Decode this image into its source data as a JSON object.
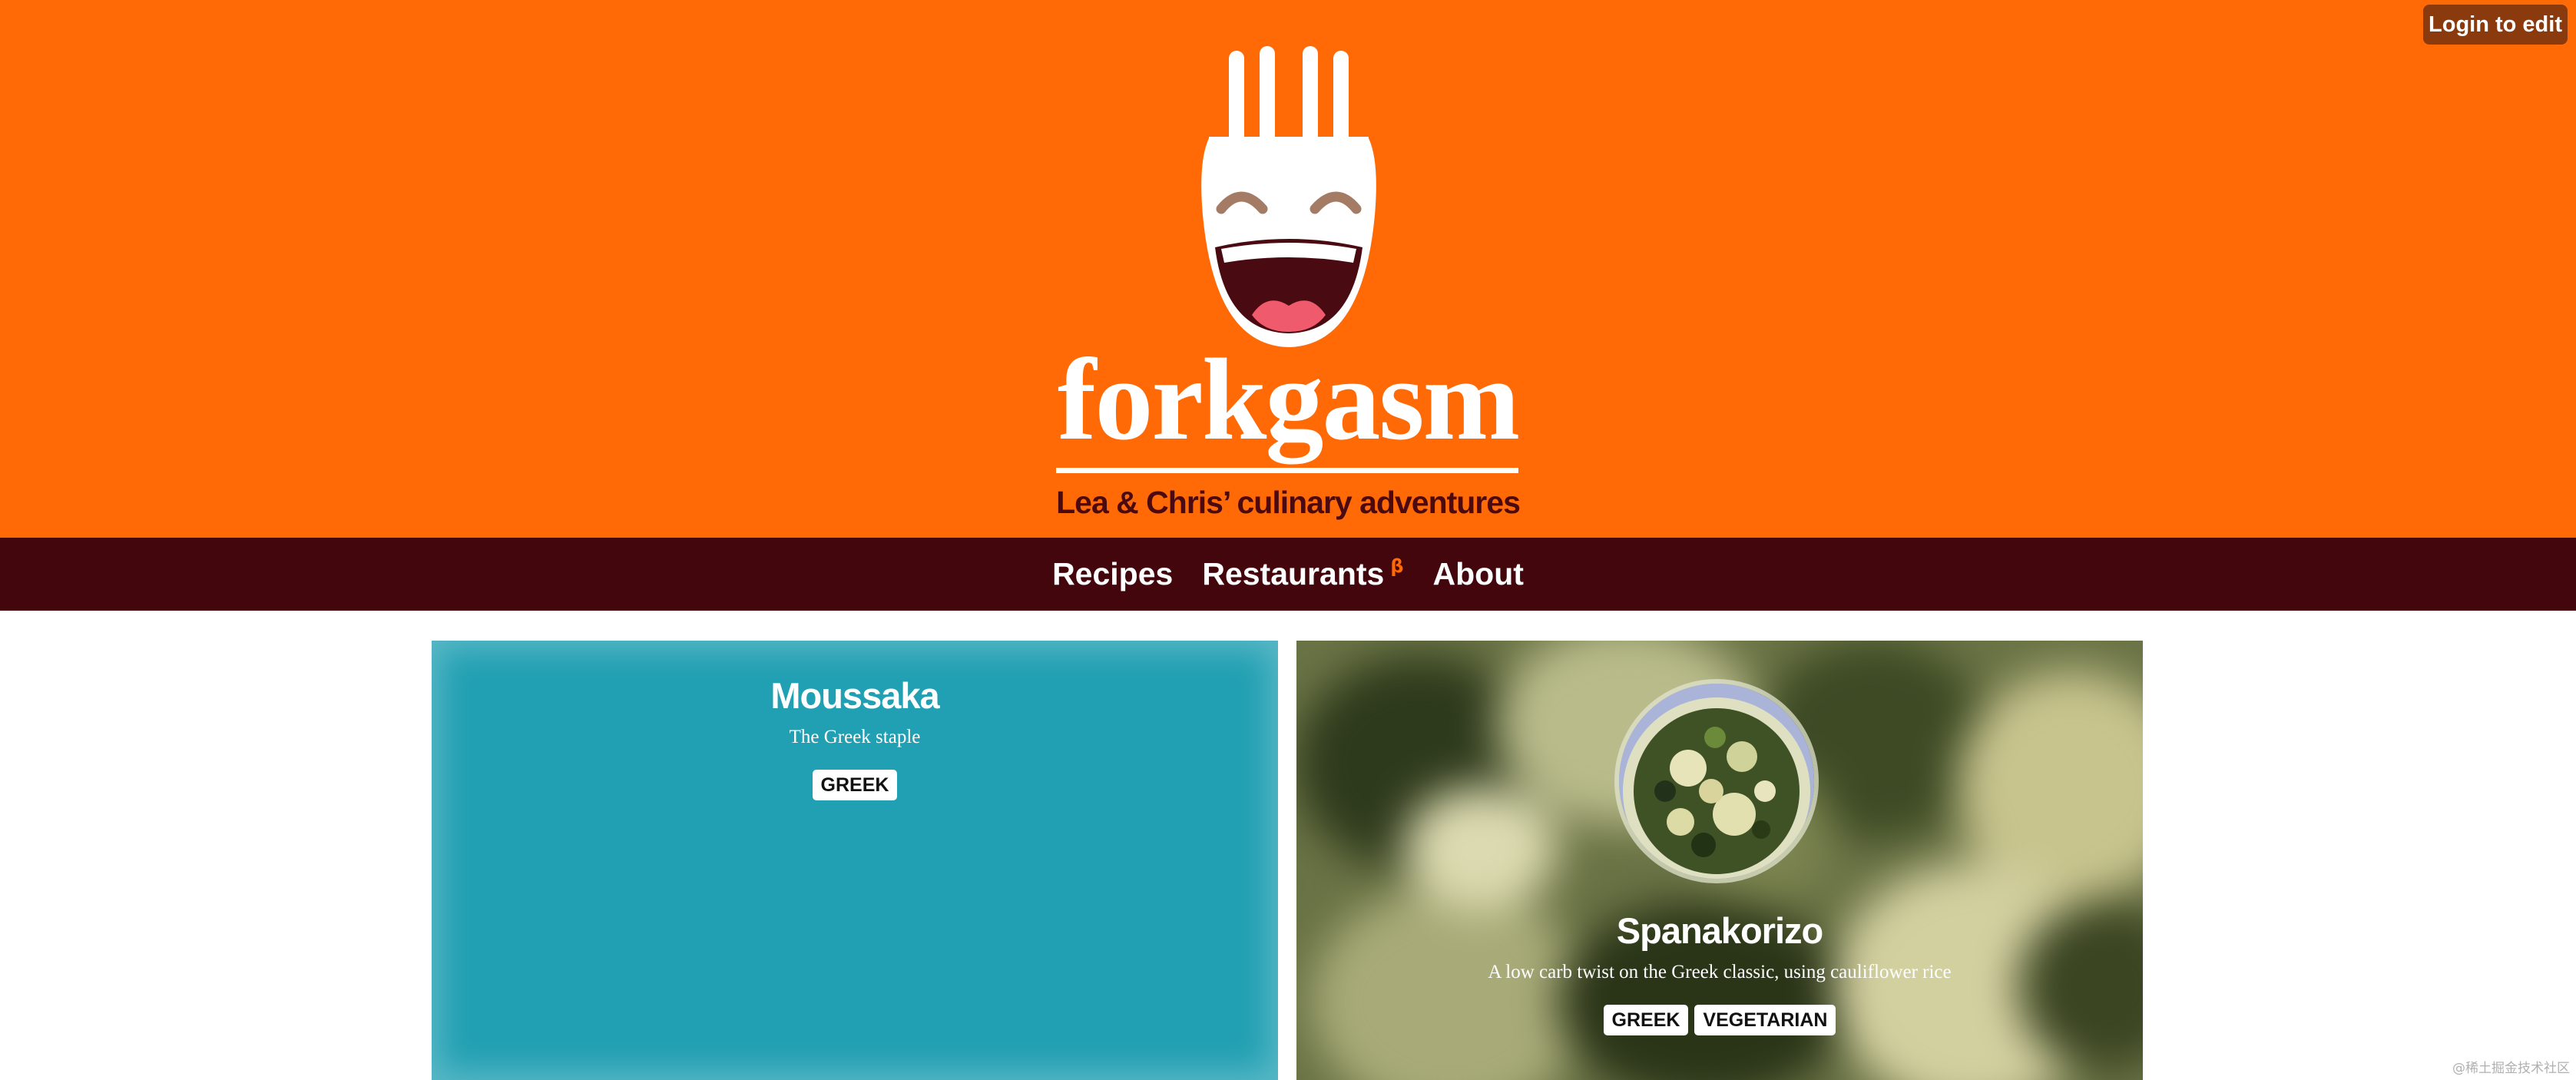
{
  "header": {
    "login_label": "Login to edit",
    "logo_wordmark": "forkgasm",
    "tagline": "Lea & Chris’ culinary adventures"
  },
  "nav": {
    "items": [
      {
        "label": "Recipes"
      },
      {
        "label": "Restaurants",
        "badge": "β"
      },
      {
        "label": "About"
      }
    ]
  },
  "cards": [
    {
      "title": "Moussaka",
      "subtitle": "The Greek staple",
      "tags": [
        "GREEK"
      ]
    },
    {
      "title": "Spanakorizo",
      "subtitle": "A low carb twist on the Greek classic, using cauliflower rice",
      "tags": [
        "GREEK",
        "VEGETARIAN"
      ]
    }
  ],
  "watermark": "@稀土掘金技术社区",
  "colors": {
    "brand_orange": "#ff6a07",
    "nav_maroon": "#43060d",
    "card_teal": "#22a0b3",
    "login_bg": "#8a3a0c"
  }
}
